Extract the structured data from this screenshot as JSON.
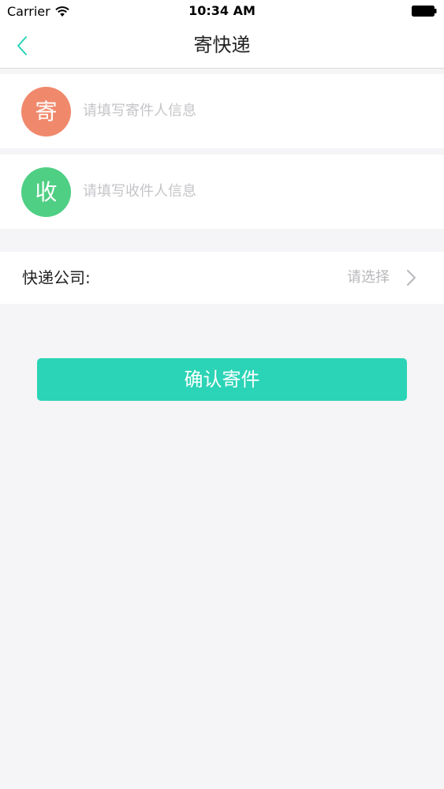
{
  "status_bar": {
    "carrier": "Carrier",
    "time": "10:34 AM",
    "wifi_icon": "wifi-icon",
    "battery_icon": "battery-icon"
  },
  "nav": {
    "title": "寄快递",
    "back_icon": "chevron-left-icon"
  },
  "sender": {
    "avatar_char": "寄",
    "placeholder": "请填写寄件人信息"
  },
  "receiver": {
    "avatar_char": "收",
    "placeholder": "请填写收件人信息"
  },
  "courier": {
    "label": "快递公司:",
    "value": "请选择",
    "chevron_icon": "chevron-right-icon"
  },
  "confirm": {
    "label": "确认寄件"
  },
  "colors": {
    "accent": "#2bd4b6",
    "sender_avatar": "#f0896c",
    "receiver_avatar": "#4fcf84",
    "background": "#f5f4f6"
  }
}
